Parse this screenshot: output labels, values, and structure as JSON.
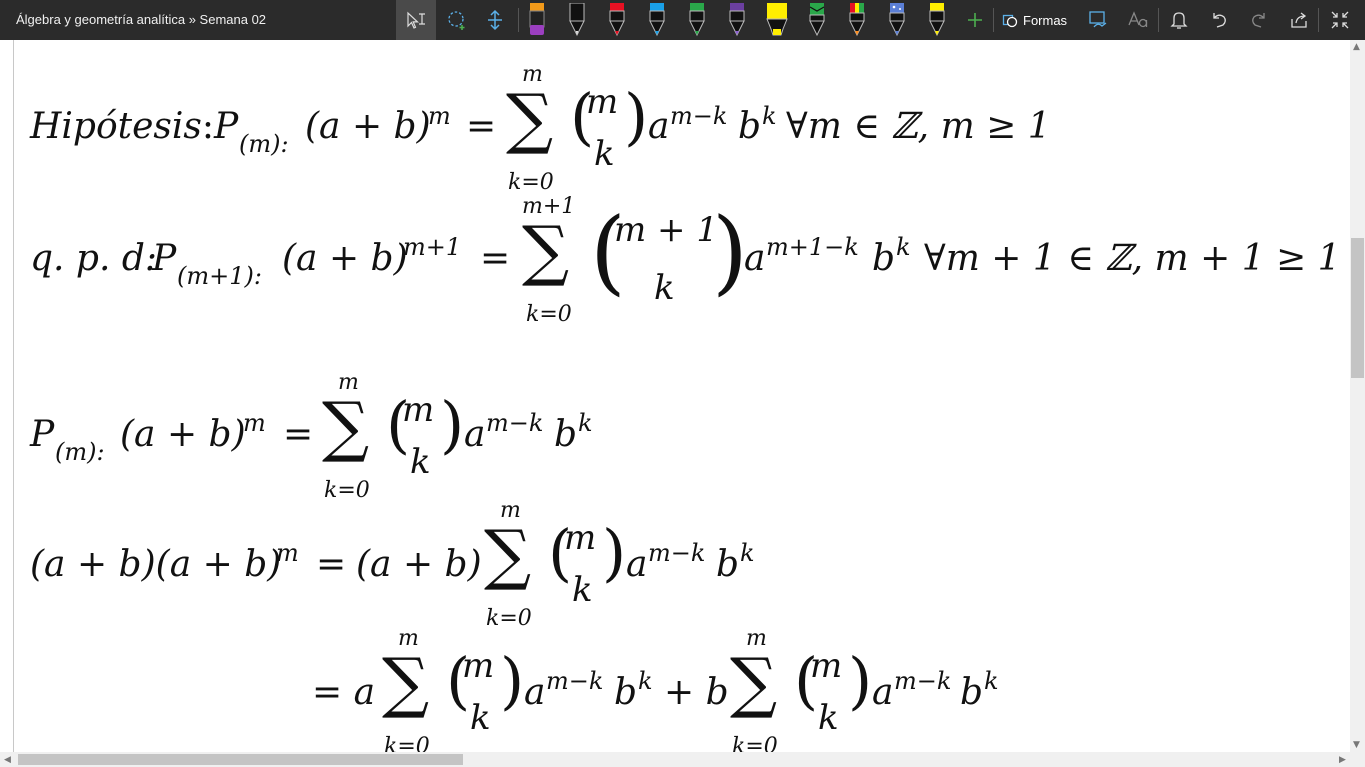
{
  "toolbar": {
    "title": "Álgebra y geometría analítica » Semana 02",
    "shapes_label": "Formas",
    "pen_colors": [
      "#f29a1a",
      "#ffffff",
      "#e81123",
      "#1aa0e8",
      "#2aa84a",
      "#6b3fa0",
      "#ffee00",
      "#2aa84a",
      "#ff8c1a",
      "#5b7fd6",
      "#ffee00"
    ],
    "accent": "#5bb0e8",
    "add_color": "#4caf50"
  },
  "math": {
    "hyp_label": "Hipótesis",
    "hyp_sub": "(m):",
    "qpd_label": "q. p. d:",
    "qpd_sub": "(m+1):",
    "pm_label": "P",
    "lhs_m": "(a + b)",
    "exp_m": "m",
    "exp_m1": "m+1",
    "eq": "=",
    "sum_top_m": "m",
    "sum_top_m1": "m+1",
    "sum_bottom": "k=0",
    "binom_top_m": "m",
    "binom_top_m1": "m + 1",
    "binom_bottom": "k",
    "term_a": "a",
    "term_a_exp": "m−k",
    "term_a_exp1": "m+1−k",
    "term_b": "b",
    "term_b_exp": "k",
    "cond_m": "∀m ∈ ℤ, m ≥ 1",
    "cond_m1": "∀m + 1 ∈ ℤ, m + 1 ≥ 1",
    "line4_lhs": "(a + b)(a + b)",
    "line4_rhs": "(a + b)",
    "line5_a": "= a",
    "line5_plus_b": "+ b"
  }
}
